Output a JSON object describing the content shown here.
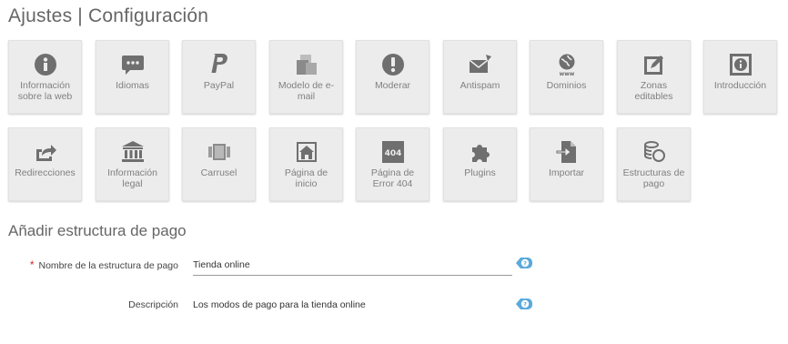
{
  "page": {
    "title": "Ajustes | Configuración"
  },
  "tiles": [
    {
      "label": "Información sobre la web",
      "icon": "info-circle-icon"
    },
    {
      "label": "Idiomas",
      "icon": "chat-bubble-icon"
    },
    {
      "label": "PayPal",
      "icon": "paypal-icon"
    },
    {
      "label": "Modelo de e-mail",
      "icon": "documents-icon"
    },
    {
      "label": "Moderar",
      "icon": "alert-circle-icon"
    },
    {
      "label": "Antispam",
      "icon": "envelope-icon"
    },
    {
      "label": "Dominios",
      "icon": "globe-www-icon"
    },
    {
      "label": "Zonas editables",
      "icon": "edit-box-icon"
    },
    {
      "label": "Introducción",
      "icon": "info-box-icon"
    },
    {
      "label": "Redirecciones",
      "icon": "share-arrow-icon"
    },
    {
      "label": "Información legal",
      "icon": "bank-building-icon"
    },
    {
      "label": "Carrusel",
      "icon": "carousel-icon"
    },
    {
      "label": "Página de inicio",
      "icon": "home-page-icon"
    },
    {
      "label": "Página de Error 404",
      "icon": "error-404-icon"
    },
    {
      "label": "Plugins",
      "icon": "puzzle-icon"
    },
    {
      "label": "Importar",
      "icon": "import-file-icon"
    },
    {
      "label": "Estructuras de pago",
      "icon": "coins-stack-icon"
    }
  ],
  "form": {
    "title": "Añadir estructura de pago",
    "required_marker": "*",
    "name_label": "Nombre de la estructura de pago",
    "name_value": "Tienda online",
    "description_label": "Descripción",
    "description_value": "Los modos de pago para la tienda online"
  },
  "colors": {
    "tile_bg": "#ececec",
    "icon_gray": "#6f6f6f",
    "help_accent": "#5aa9dc",
    "required": "#d9262a"
  }
}
